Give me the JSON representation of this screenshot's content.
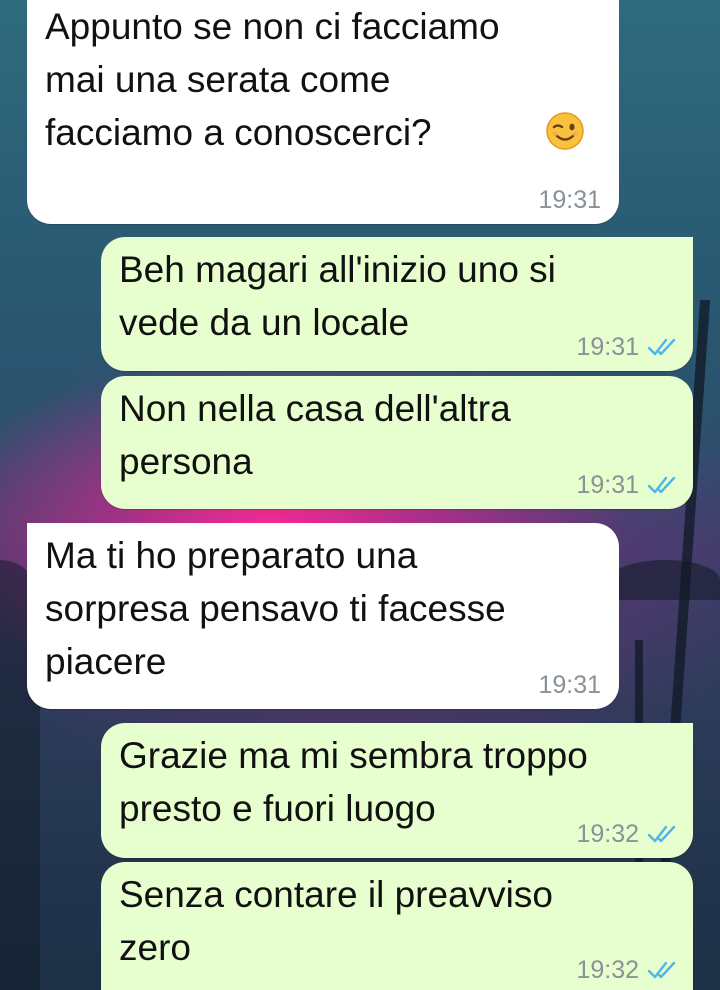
{
  "messages": [
    {
      "id": "m1",
      "direction": "incoming",
      "text": "Appunto se non ci facciamo\nmai una serata come\nfacciamo a conoscerci?",
      "emoji": "winking-face",
      "time": "19:31"
    },
    {
      "id": "m2",
      "direction": "outgoing",
      "text": "Beh magari all'inizio uno si\nvede da un locale",
      "time": "19:31",
      "status": "read"
    },
    {
      "id": "m3",
      "direction": "outgoing",
      "text": "Non nella casa dell'altra\npersona",
      "time": "19:31",
      "status": "read"
    },
    {
      "id": "m4",
      "direction": "incoming",
      "text": "Ma ti ho preparato una\nsorpresa pensavo ti facesse\npiacere",
      "time": "19:31"
    },
    {
      "id": "m5",
      "direction": "outgoing",
      "text": "Grazie ma mi sembra troppo\npresto e fuori luogo",
      "time": "19:32",
      "status": "read"
    },
    {
      "id": "m6",
      "direction": "outgoing",
      "text": "Senza contare il preavviso\nzero",
      "time": "19:32",
      "status": "read"
    }
  ],
  "colors": {
    "incoming_bubble": "#ffffff",
    "outgoing_bubble": "#e7fece",
    "read_ticks": "#4fb6ec",
    "timestamp": "#8a9197"
  }
}
